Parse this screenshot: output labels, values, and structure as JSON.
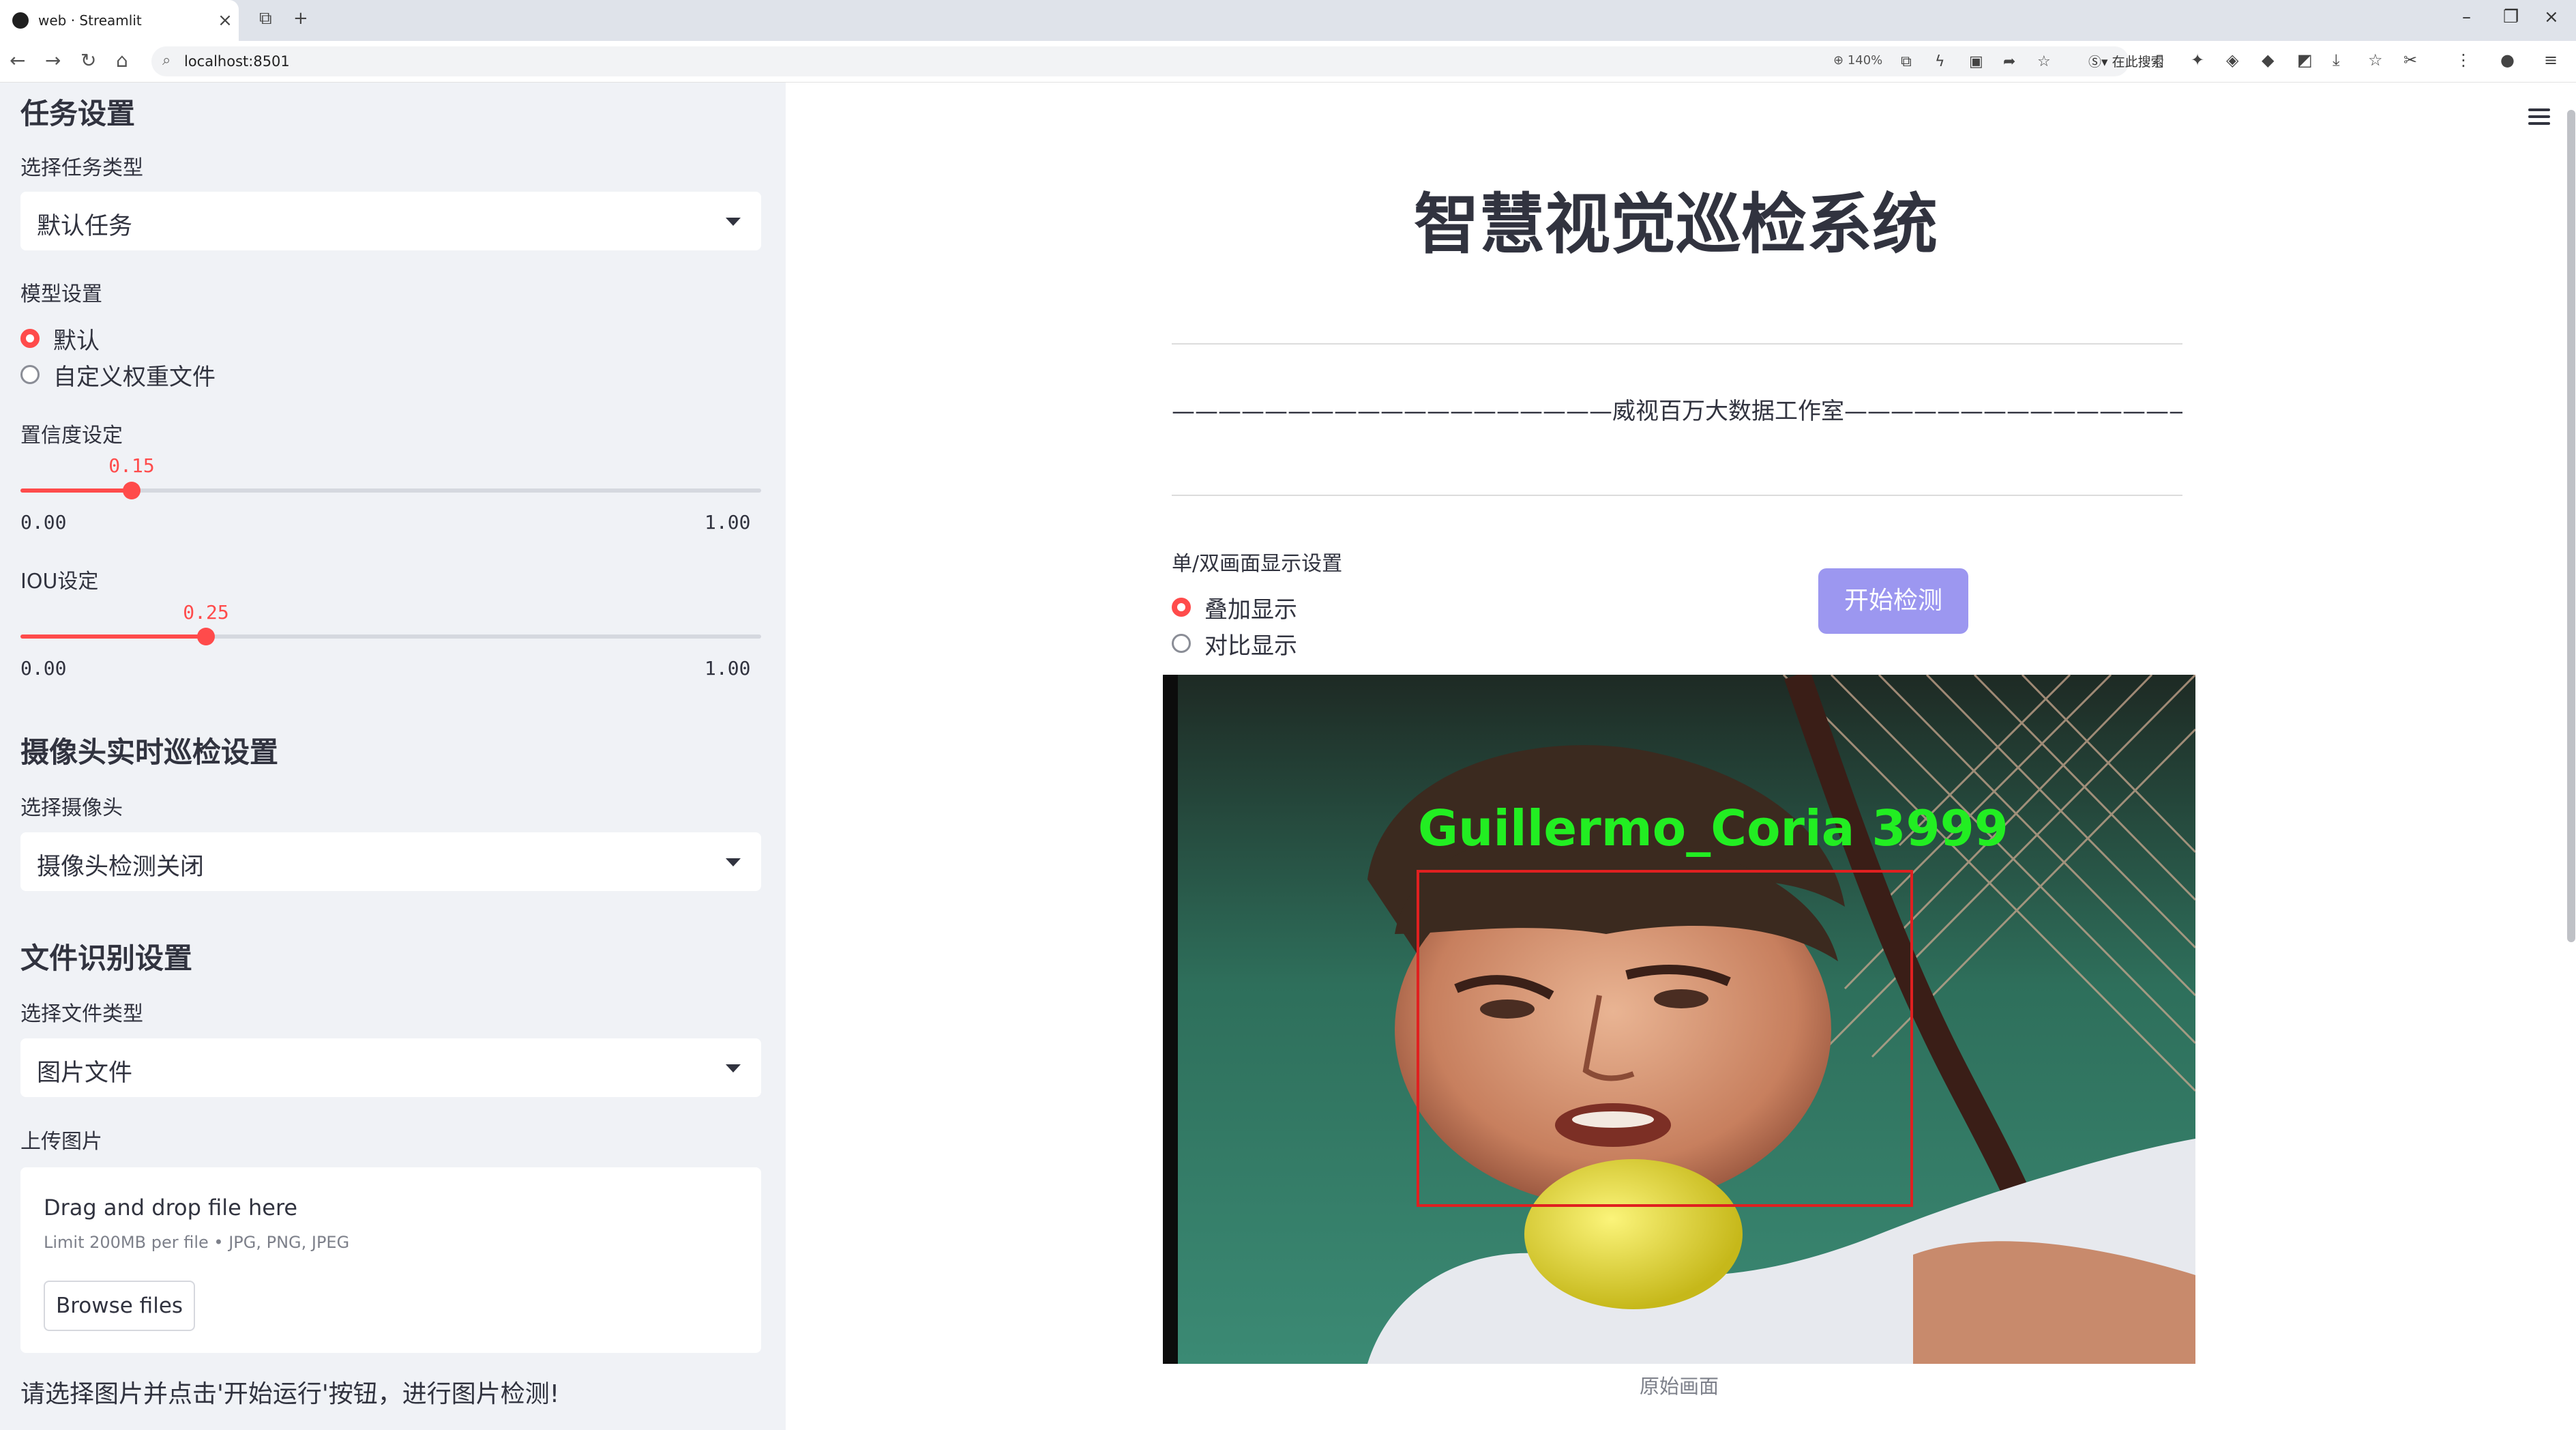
{
  "browser": {
    "tab_title": "web · Streamlit",
    "address": "localhost:8501",
    "zoom": "140%",
    "search_placeholder": "在此搜索"
  },
  "sidebar": {
    "task_section": "任务设置",
    "task_type_label": "选择任务类型",
    "task_type_value": "默认任务",
    "model_label": "模型设置",
    "model_options": [
      "默认",
      "自定义权重文件"
    ],
    "model_selected": "默认",
    "confidence": {
      "label": "置信度设定",
      "value": "0.15",
      "min": "0.00",
      "max": "1.00",
      "fraction": 0.15
    },
    "iou": {
      "label": "IOU设定",
      "value": "0.25",
      "min": "0.00",
      "max": "1.00",
      "fraction": 0.25
    },
    "camera_section": "摄像头实时巡检设置",
    "camera_label": "选择摄像头",
    "camera_value": "摄像头检测关闭",
    "file_section": "文件识别设置",
    "file_type_label": "选择文件类型",
    "file_type_value": "图片文件",
    "upload_label": "上传图片",
    "upload_title": "Drag and drop file here",
    "upload_limit": "Limit 200MB per file • JPG, PNG, JPEG",
    "browse_label": "Browse files",
    "hint": "请选择图片并点击'开始运行'按钮，进行图片检测!"
  },
  "main": {
    "title": "智慧视觉巡检系统",
    "studio": "———————————————————威视百万大数据工作室————————————————————",
    "display_label": "单/双画面显示设置",
    "display_options": [
      "叠加显示",
      "对比显示"
    ],
    "display_selected": "叠加显示",
    "start_button": "开始检测",
    "detection_label": "Guillermo_Coria 3999",
    "caption": "原始画面"
  },
  "colors": {
    "accent": "#ff4b4b",
    "button": "#9c97f0",
    "sidebar_bg": "#f0f2f6",
    "detection_box": "#e02020",
    "detection_text": "#22ee22"
  }
}
